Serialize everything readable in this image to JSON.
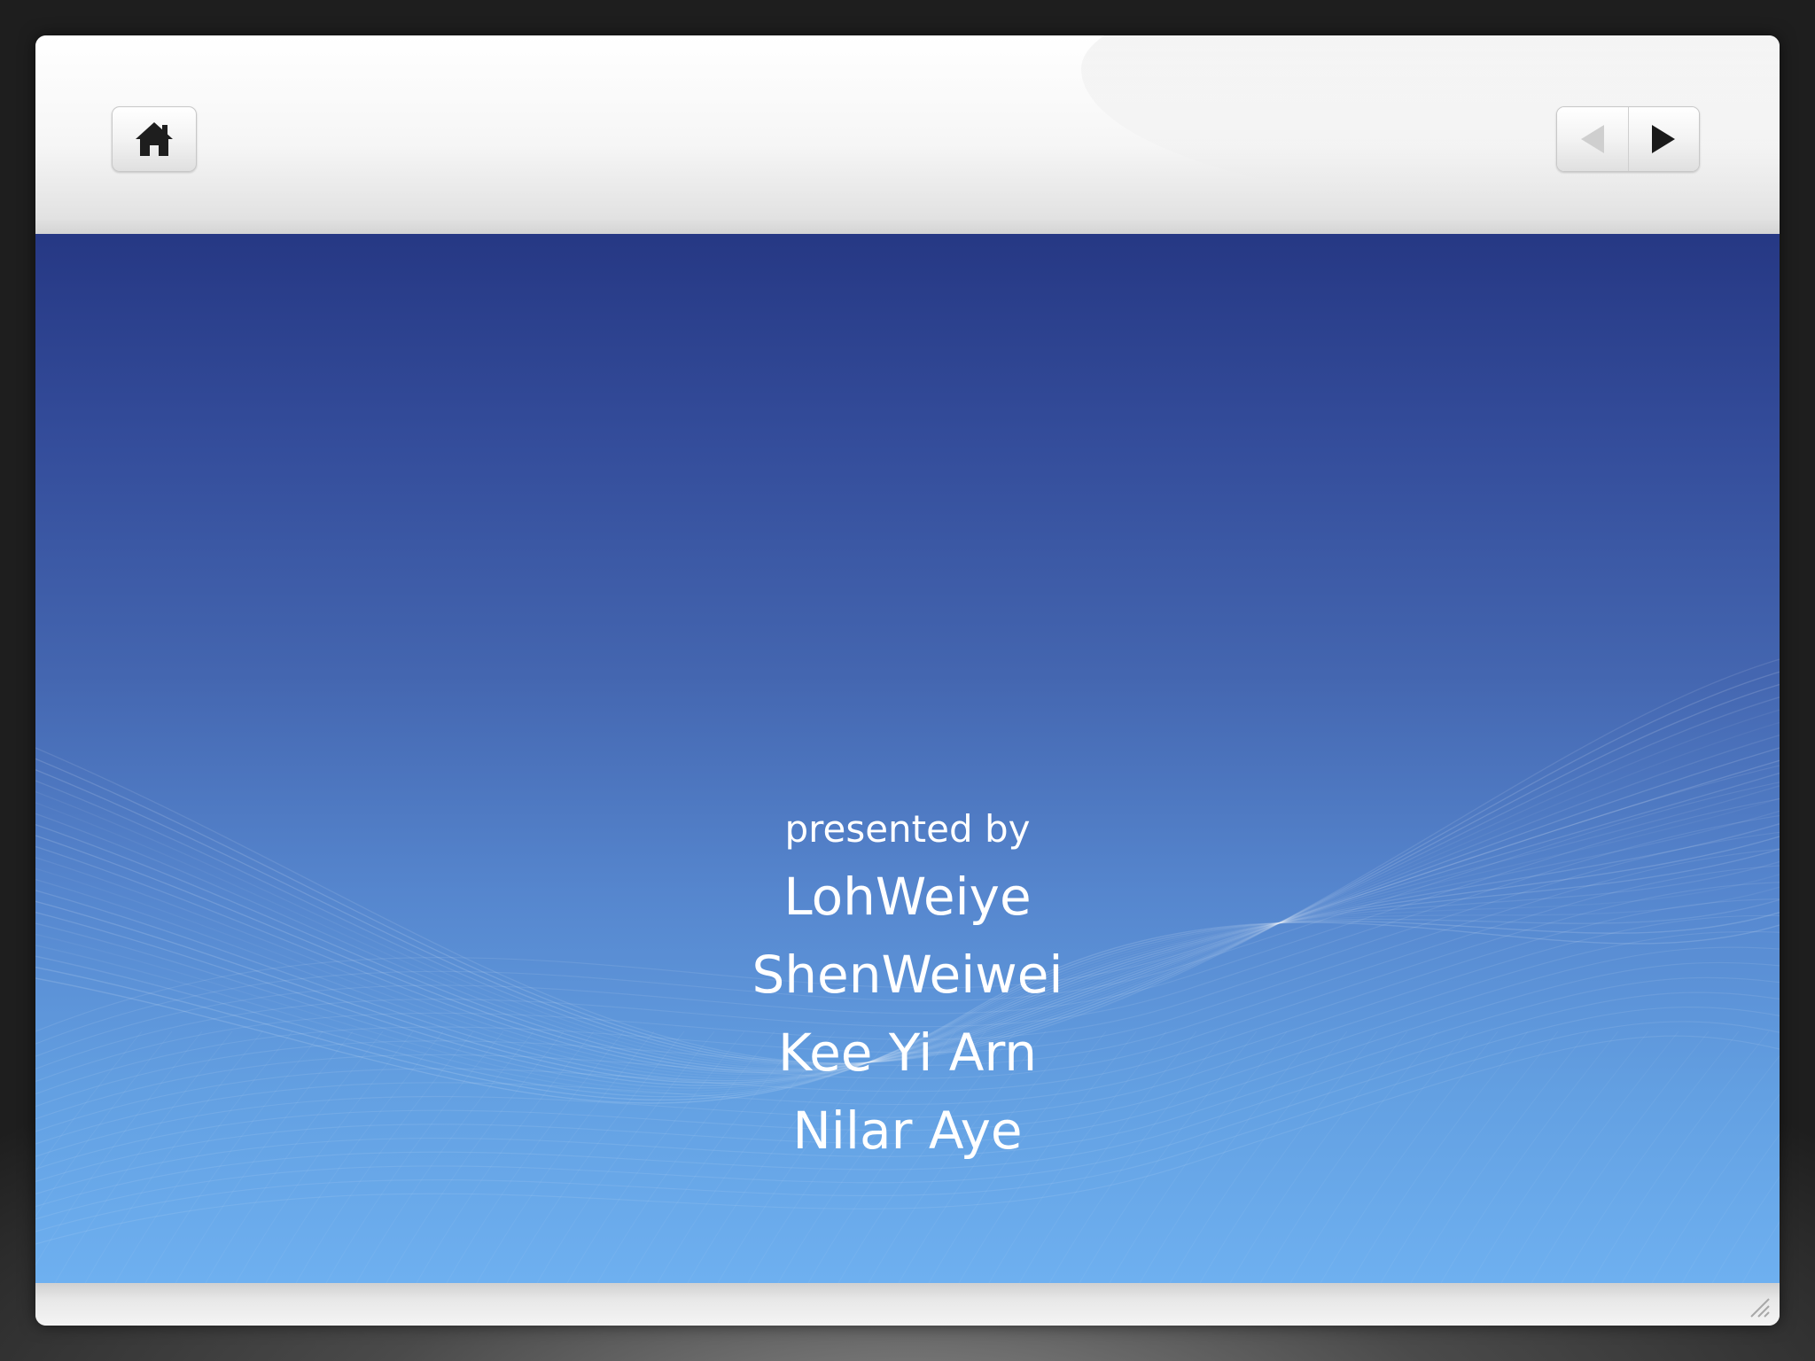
{
  "toolbar": {
    "home_icon": "home-icon",
    "prev_icon": "triangle-left-icon",
    "next_icon": "triangle-right-icon"
  },
  "slide": {
    "presented_by_label": "presented by",
    "presenters": [
      "LohWeiye",
      "ShenWeiwei",
      "Kee Yi Arn",
      "Nilar Aye"
    ]
  },
  "colors": {
    "slide_top": "#263884",
    "slide_bottom": "#6eb0f0",
    "text": "#ffffff"
  }
}
